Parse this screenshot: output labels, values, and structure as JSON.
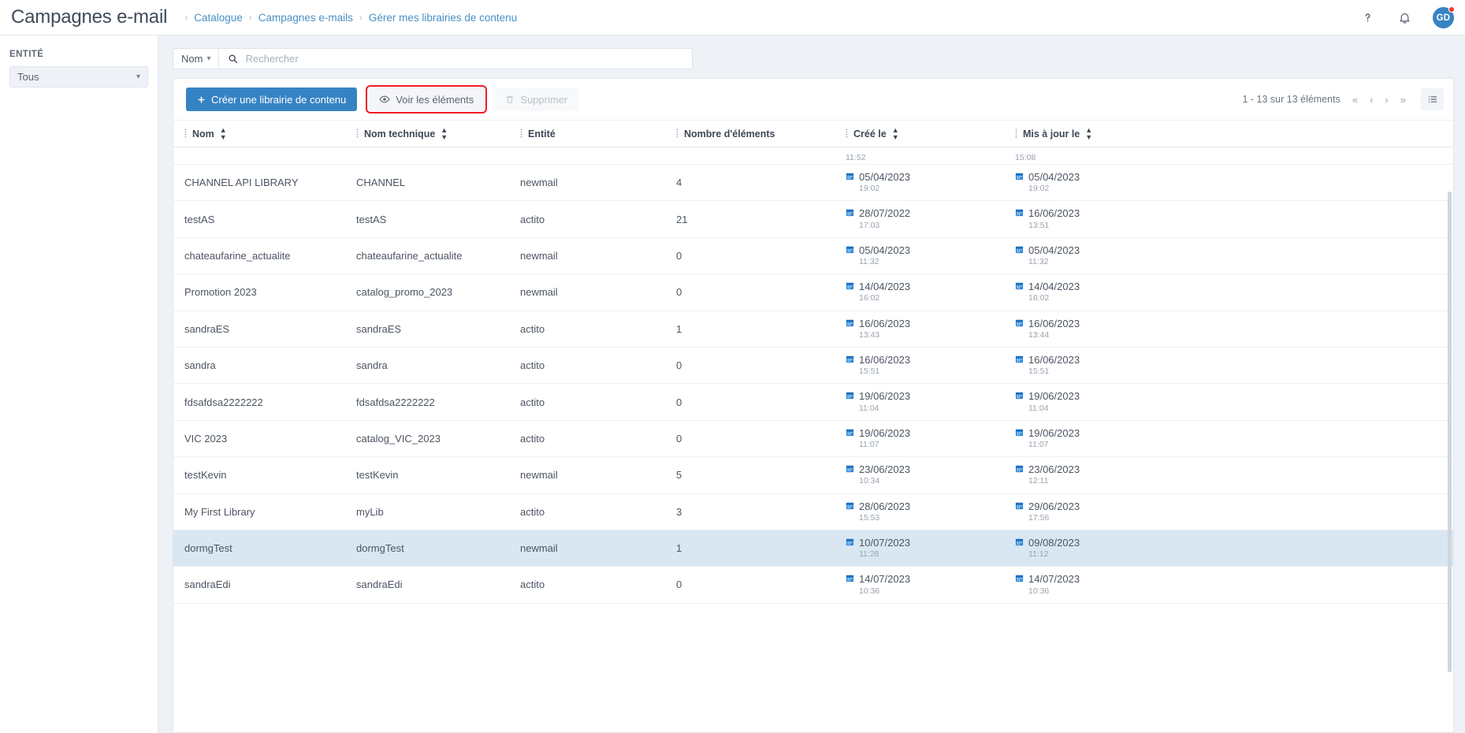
{
  "header": {
    "app_title": "Campagnes e-mail",
    "breadcrumb": [
      "Catalogue",
      "Campagnes e-mails",
      "Gérer mes librairies de contenu"
    ],
    "help_icon": "question-mark-icon",
    "bell_icon": "notification-bell-icon",
    "avatar_initials": "GD",
    "accent_color": "#3683c4",
    "notification_dot_color": "#f5372b"
  },
  "sidebar": {
    "label": "ENTITÉ",
    "entity_selected": "Tous"
  },
  "search": {
    "field_label": "Nom",
    "placeholder": "Rechercher",
    "value": ""
  },
  "toolbar": {
    "create_label": "Créer une librairie de contenu",
    "view_elements_label": "Voir les éléments",
    "delete_label": "Supprimer",
    "delete_disabled": true,
    "view_elements_highlighted": true,
    "highlight_color": "#ee1b24",
    "pagination_text": "1 - 13 sur 13 éléments",
    "pager_first": "«",
    "pager_prev": "‹",
    "pager_next": "›",
    "pager_last": "»"
  },
  "table": {
    "columns": [
      {
        "label": "Nom",
        "sortable": true
      },
      {
        "label": "Nom technique",
        "sortable": true
      },
      {
        "label": "Entité",
        "sortable": false
      },
      {
        "label": "Nombre d'éléments",
        "sortable": false
      },
      {
        "label": "Créé le",
        "sortable": true
      },
      {
        "label": "Mis à jour le",
        "sortable": true
      }
    ],
    "clipped_row": {
      "created_time": "11:52",
      "updated_time": "15:08"
    },
    "rows": [
      {
        "nom": "CHANNEL API LIBRARY",
        "technique": "CHANNEL",
        "entite": "newmail",
        "nombre": "4",
        "cree_date": "05/04/2023",
        "cree_time": "19:02",
        "maj_date": "05/04/2023",
        "maj_time": "19:02",
        "selected": false
      },
      {
        "nom": "testAS",
        "technique": "testAS",
        "entite": "actito",
        "nombre": "21",
        "cree_date": "28/07/2022",
        "cree_time": "17:03",
        "maj_date": "16/06/2023",
        "maj_time": "13:51",
        "selected": false
      },
      {
        "nom": "chateaufarine_actualite",
        "technique": "chateaufarine_actualite",
        "entite": "newmail",
        "nombre": "0",
        "cree_date": "05/04/2023",
        "cree_time": "11:32",
        "maj_date": "05/04/2023",
        "maj_time": "11:32",
        "selected": false
      },
      {
        "nom": "Promotion 2023",
        "technique": "catalog_promo_2023",
        "entite": "newmail",
        "nombre": "0",
        "cree_date": "14/04/2023",
        "cree_time": "16:02",
        "maj_date": "14/04/2023",
        "maj_time": "16:02",
        "selected": false
      },
      {
        "nom": "sandraES",
        "technique": "sandraES",
        "entite": "actito",
        "nombre": "1",
        "cree_date": "16/06/2023",
        "cree_time": "13:43",
        "maj_date": "16/06/2023",
        "maj_time": "13:44",
        "selected": false
      },
      {
        "nom": "sandra",
        "technique": "sandra",
        "entite": "actito",
        "nombre": "0",
        "cree_date": "16/06/2023",
        "cree_time": "15:51",
        "maj_date": "16/06/2023",
        "maj_time": "15:51",
        "selected": false
      },
      {
        "nom": "fdsafdsa2222222",
        "technique": "fdsafdsa2222222",
        "entite": "actito",
        "nombre": "0",
        "cree_date": "19/06/2023",
        "cree_time": "11:04",
        "maj_date": "19/06/2023",
        "maj_time": "11:04",
        "selected": false
      },
      {
        "nom": "VIC 2023",
        "technique": "catalog_VIC_2023",
        "entite": "actito",
        "nombre": "0",
        "cree_date": "19/06/2023",
        "cree_time": "11:07",
        "maj_date": "19/06/2023",
        "maj_time": "11:07",
        "selected": false
      },
      {
        "nom": "testKevin",
        "technique": "testKevin",
        "entite": "newmail",
        "nombre": "5",
        "cree_date": "23/06/2023",
        "cree_time": "10:34",
        "maj_date": "23/06/2023",
        "maj_time": "12:11",
        "selected": false
      },
      {
        "nom": "My First Library",
        "technique": "myLib",
        "entite": "actito",
        "nombre": "3",
        "cree_date": "28/06/2023",
        "cree_time": "15:53",
        "maj_date": "29/06/2023",
        "maj_time": "17:56",
        "selected": false
      },
      {
        "nom": "dormgTest",
        "technique": "dormgTest",
        "entite": "newmail",
        "nombre": "1",
        "cree_date": "10/07/2023",
        "cree_time": "11:28",
        "maj_date": "09/08/2023",
        "maj_time": "11:12",
        "selected": true
      },
      {
        "nom": "sandraEdi",
        "technique": "sandraEdi",
        "entite": "actito",
        "nombre": "0",
        "cree_date": "14/07/2023",
        "cree_time": "10:36",
        "maj_date": "14/07/2023",
        "maj_time": "10:36",
        "selected": false
      }
    ]
  }
}
